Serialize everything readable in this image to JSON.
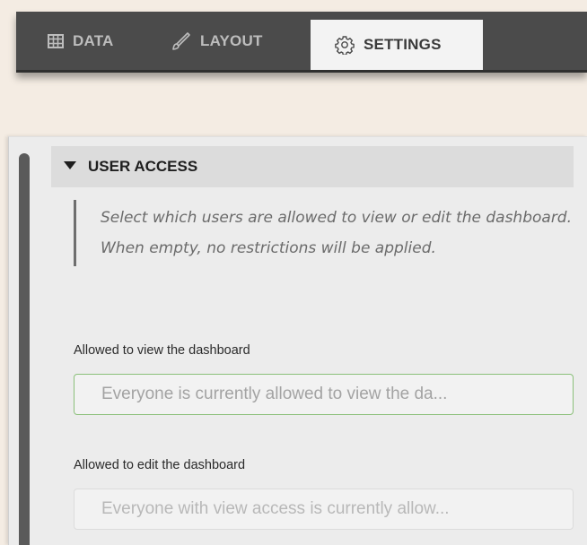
{
  "tabs": [
    {
      "label": "DATA",
      "icon": "table-icon",
      "active": false
    },
    {
      "label": "LAYOUT",
      "icon": "brush-icon",
      "active": false
    },
    {
      "label": "SETTINGS",
      "icon": "gear-icon",
      "active": true
    }
  ],
  "section": {
    "title": "USER ACCESS",
    "expanded": true,
    "description": "Select which users are allowed to view or edit the dashboard. When empty, no restrictions will be applied."
  },
  "fields": {
    "view": {
      "label": "Allowed to view the dashboard",
      "placeholder": "Everyone is currently allowed to view the da...",
      "focused": true
    },
    "edit": {
      "label": "Allowed to edit the dashboard",
      "placeholder": "Everyone with view access is currently allow...",
      "focused": false
    }
  },
  "colors": {
    "tabbar": "#4b4b4b",
    "active_tab": "#f3f3f3",
    "focus_border": "#8bc07a",
    "background": "#f4ece3"
  }
}
